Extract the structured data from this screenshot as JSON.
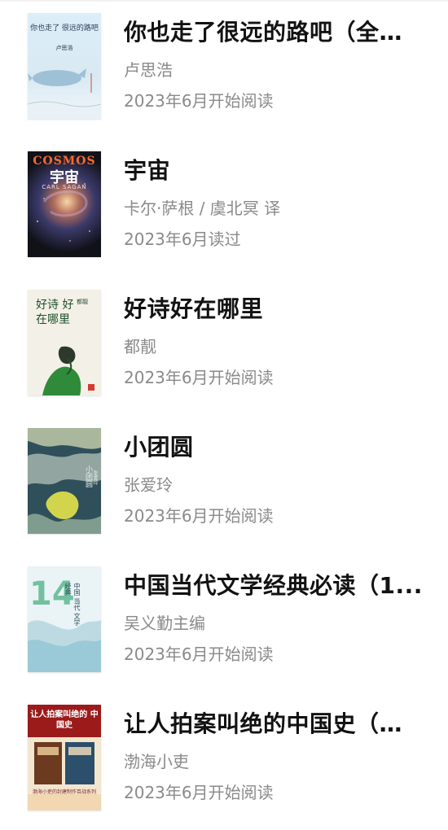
{
  "books": [
    {
      "title": "你也走了很远的路吧（全新...",
      "author": "卢思浩",
      "status": "2023年6月开始阅读",
      "cover": {
        "title_text": "你也走了 很远的路吧",
        "author_text": "卢思浩",
        "bg": "#cfe6f3",
        "accent": "#7aa7c9"
      }
    },
    {
      "title": "宇宙",
      "author": "卡尔·萨根 / 虞北冥 译",
      "status": "2023年6月读过",
      "cover": {
        "title_text": "宇宙",
        "latin_text": "COSMOS",
        "author_text": "CARL SAGAN",
        "bg": "#0f1116",
        "accent": "#ff6a2b"
      }
    },
    {
      "title": "好诗好在哪里",
      "author": "都靓",
      "status": "2023年6月开始阅读",
      "cover": {
        "title_text": "好诗 好在哪里",
        "author_text": "都靓",
        "bg": "#f3f0e7",
        "accent": "#2f8b3a"
      }
    },
    {
      "title": "小团圆",
      "author": "张爱玲",
      "status": "2023年6月开始阅读",
      "cover": {
        "title_text": "小团圆",
        "author_text": "张爱玲",
        "bg": "#2f4f5a",
        "accent": "#d2d54c"
      }
    },
    {
      "title": "中国当代文学经典必读（1...",
      "author": "吴义勤主编",
      "status": "2023年6月开始阅读",
      "cover": {
        "title_text": "中国 当代 文学 经典",
        "number_text": "14",
        "bg": "#eaf3f6",
        "accent": "#73c0a0"
      }
    },
    {
      "title": "让人拍案叫绝的中国史（套...",
      "author": "渤海小吏",
      "status": "2023年6月开始阅读",
      "cover": {
        "title_text": "让人拍案叫绝的 中国史",
        "subtitle_text": "渤海小吏的封建制作百战系列",
        "bg": "#9b1b1b",
        "accent": "#f3e6cf"
      }
    }
  ]
}
